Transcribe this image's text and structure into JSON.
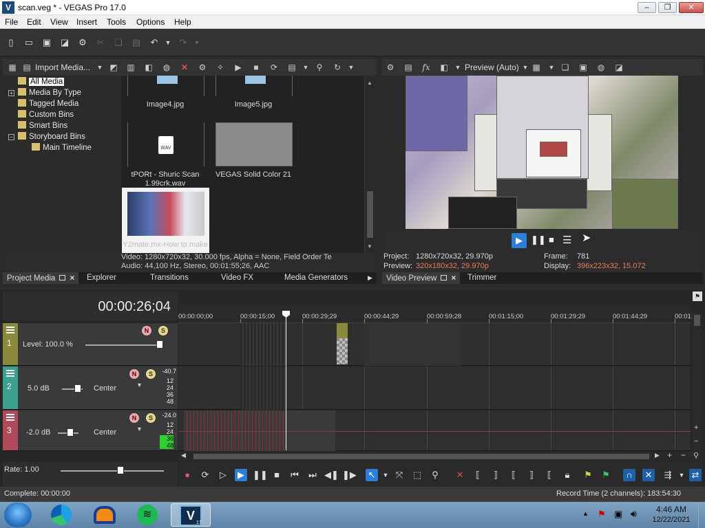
{
  "window": {
    "title": "scan.veg * - VEGAS Pro 17.0",
    "logo_letter": "V",
    "minimize": "–",
    "maximize": "❐",
    "close": "✕"
  },
  "menu": [
    "File",
    "Edit",
    "View",
    "Insert",
    "Tools",
    "Options",
    "Help"
  ],
  "project_media": {
    "import_label": "Import Media...",
    "tree": [
      {
        "label": "All Media",
        "selected": true
      },
      {
        "label": "Media By Type",
        "expander": "+"
      },
      {
        "label": "Tagged Media"
      },
      {
        "label": "Custom Bins"
      },
      {
        "label": "Smart Bins"
      },
      {
        "label": "Storyboard Bins",
        "expander": "−"
      },
      {
        "label": "Main Timeline"
      }
    ],
    "thumbs": [
      {
        "label": "Image4.jpg"
      },
      {
        "label": "Image5.jpg"
      },
      {
        "label": "tPORt - Shuric Scan 1.99crk.wav",
        "badge": "WAV"
      },
      {
        "label": "VEGAS Solid Color 21"
      },
      {
        "label": "Y2mate.mx-How to make"
      }
    ],
    "info_line1": "Video: 1280x720x32, 30.000 fps, Alpha = None, Field Order Te",
    "info_line2": "Audio: 44,100 Hz, Stereo, 00:01:55;26, AAC"
  },
  "left_tabs": {
    "project_media": "Project Media",
    "explorer": "Explorer",
    "transitions": "Transitions",
    "video_fx": "Video FX",
    "media_generators": "Media Generators"
  },
  "preview": {
    "mode": "Preview (Auto)",
    "project_label": "Project:",
    "project_value": "1280x720x32, 29.970p",
    "preview_label": "Preview:",
    "preview_value": "320x180x32, 29.970p",
    "frame_label": "Frame:",
    "frame_value": "781",
    "display_label": "Display:",
    "display_value": "396x223x32, 15.072",
    "tab_video_preview": "Video Preview",
    "tab_trimmer": "Trimmer"
  },
  "timeline": {
    "time": "00:00:26;04",
    "ruler": [
      "00:00:00;00",
      "00:00:15;00",
      "00:00:29;29",
      "00:00:44;29",
      "00:00:59;28",
      "00:01:15;00",
      "00:01:29;29",
      "00:01:44;29",
      "00:01:"
    ],
    "tracks": [
      {
        "num": "1",
        "color": "#8a8a3c",
        "level": "Level: 100.0 %"
      },
      {
        "num": "2",
        "color": "#3ca08c",
        "vol": "5.0 dB",
        "pan": "Center",
        "meter": [
          "-40.7",
          "12",
          "24",
          "36",
          "48"
        ]
      },
      {
        "num": "3",
        "color": "#b04a5a",
        "vol": "-2.0 dB",
        "pan": "Center",
        "meter": [
          "-24.0",
          "12",
          "24",
          "36",
          "48"
        ]
      }
    ],
    "rate": "Rate: 1.00"
  },
  "status": {
    "complete": "Complete: 00:00:00",
    "record_time": "Record Time (2 channels): 183:54:30"
  },
  "taskbar": {
    "time": "4:46 AM",
    "date": "12/22/2021",
    "vegas_badge": "17"
  },
  "colors": {
    "accent": "#2b7fd6",
    "orange": "#e87d5a",
    "track1": "#8a8a3c",
    "track2": "#3ca08c",
    "track3": "#b04a5a"
  }
}
